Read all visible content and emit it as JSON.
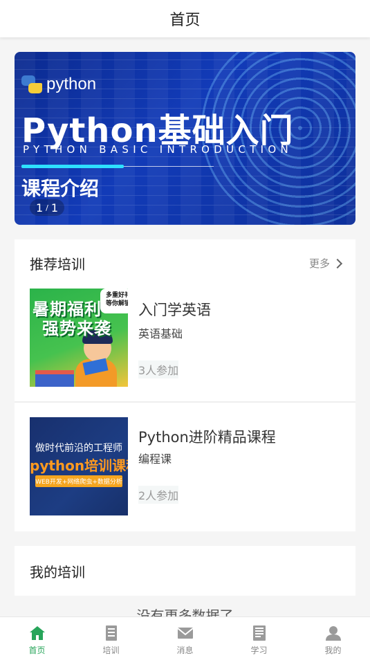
{
  "header": {
    "title": "首页"
  },
  "banner": {
    "logo_text": "python",
    "title": "Python基础入门",
    "subtitle": "PYTHON BASIC INTRODUCTION",
    "tagline": "课程介绍",
    "pager": {
      "current": "1",
      "separator": "/",
      "total": "1"
    },
    "colors": {
      "bg": "#123bb8",
      "accent_line": "#2ee0ff"
    }
  },
  "recommended": {
    "title": "推荐培训",
    "more_label": "更多",
    "items": [
      {
        "thumb": {
          "line1": "暑期福利",
          "line2": "强势来袭",
          "badge": "多重好礼等你解锁"
        },
        "name": "入门学英语",
        "category": "英语基础",
        "joined": "3人参加"
      },
      {
        "thumb": {
          "line1": "做时代前沿的工程师",
          "line2": "python培训课程",
          "line3": "WEB开发+网络爬虫+数据分析"
        },
        "name": "Python进阶精品课程",
        "category": "编程课",
        "joined": "2人参加"
      }
    ]
  },
  "my_training": {
    "title": "我的培训"
  },
  "footer_note": "没有更多数据了",
  "tabbar": {
    "active_color": "#27a55a",
    "tabs": [
      {
        "label": "首页",
        "icon": "home-icon",
        "active": true
      },
      {
        "label": "培训",
        "icon": "document-icon",
        "active": false
      },
      {
        "label": "消息",
        "icon": "mail-icon",
        "active": false
      },
      {
        "label": "学习",
        "icon": "book-icon",
        "active": false
      },
      {
        "label": "我的",
        "icon": "user-icon",
        "active": false
      }
    ]
  }
}
